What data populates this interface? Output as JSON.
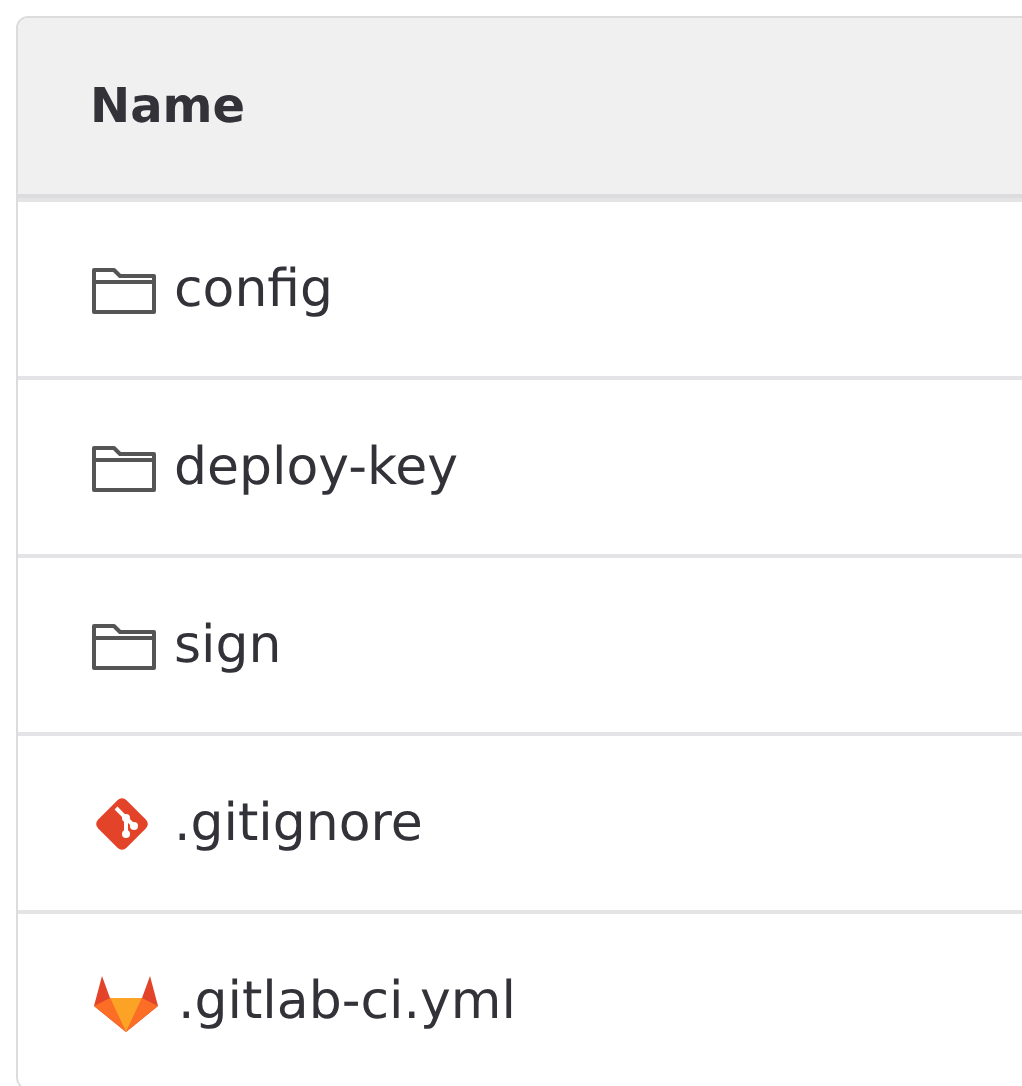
{
  "table": {
    "columns": [
      "Name"
    ],
    "rows": [
      {
        "kind": "folder",
        "name": "config"
      },
      {
        "kind": "folder",
        "name": "deploy-key"
      },
      {
        "kind": "folder",
        "name": "sign"
      },
      {
        "kind": "git",
        "name": ".gitignore"
      },
      {
        "kind": "gitlab",
        "name": ".gitlab-ci.yml"
      }
    ]
  }
}
